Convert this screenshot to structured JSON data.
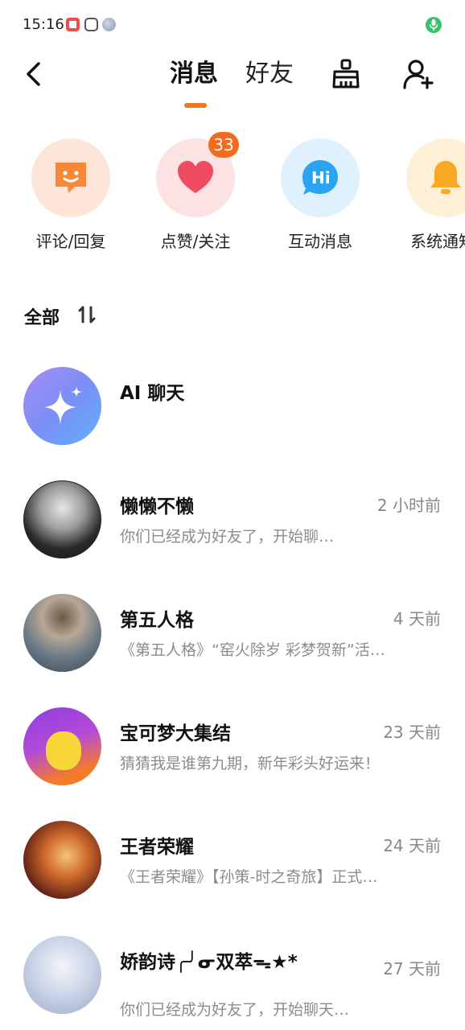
{
  "status_bar": {
    "time": "15:16",
    "icons": [
      "notification-app-icon",
      "hand-app-icon",
      "globe-app-icon",
      "microphone-active-icon"
    ],
    "mic_color": "#35c36b"
  },
  "header": {
    "back_icon": "chevron-left-icon",
    "tabs": [
      {
        "label": "消息",
        "active": true
      },
      {
        "label": "好友",
        "active": false
      }
    ],
    "accent_color": "#f0781e",
    "actions": [
      "clean-brush-icon",
      "add-friend-icon"
    ]
  },
  "quick_actions": [
    {
      "label": "评论/回复",
      "icon": "comment-smile-icon",
      "color": "#f7873a"
    },
    {
      "label": "点赞/关注",
      "icon": "heart-icon",
      "color": "#f04a61",
      "badge": "33"
    },
    {
      "label": "互动消息",
      "icon": "hi-bubble-icon",
      "color": "#2aa3f3"
    },
    {
      "label": "系统通知",
      "icon": "bell-icon",
      "color": "#f9a825"
    }
  ],
  "section": {
    "title": "全部",
    "sort_icon": "sort-icon"
  },
  "conversations": [
    {
      "name": "AI 聊天",
      "time": "",
      "preview": "",
      "avatar": "sparkle-icon"
    },
    {
      "name": "懒懒不懒",
      "time": "2 小时前",
      "preview": "你们已经成为好友了，开始聊…",
      "avatar": "user-avatar"
    },
    {
      "name": "第五人格",
      "time": "4 天前",
      "preview": "《第五人格》“窑火除岁 彩梦贺新”活动…",
      "avatar": "game-avatar"
    },
    {
      "name": "宝可梦大集结",
      "time": "23 天前",
      "preview": "猜猜我是谁第九期，新年彩头好运来！",
      "avatar": "game-avatar"
    },
    {
      "name": "王者荣耀",
      "time": "24 天前",
      "preview": "《王者荣耀》【孙策-时之奇旅】正式登…",
      "avatar": "game-avatar"
    },
    {
      "name": "娇韵诗╭╯ᓂ双萃ᯓ★*",
      "time": "27 天前",
      "preview": "你们已经成为好友了，开始聊天…",
      "avatar": "brand-avatar"
    }
  ]
}
